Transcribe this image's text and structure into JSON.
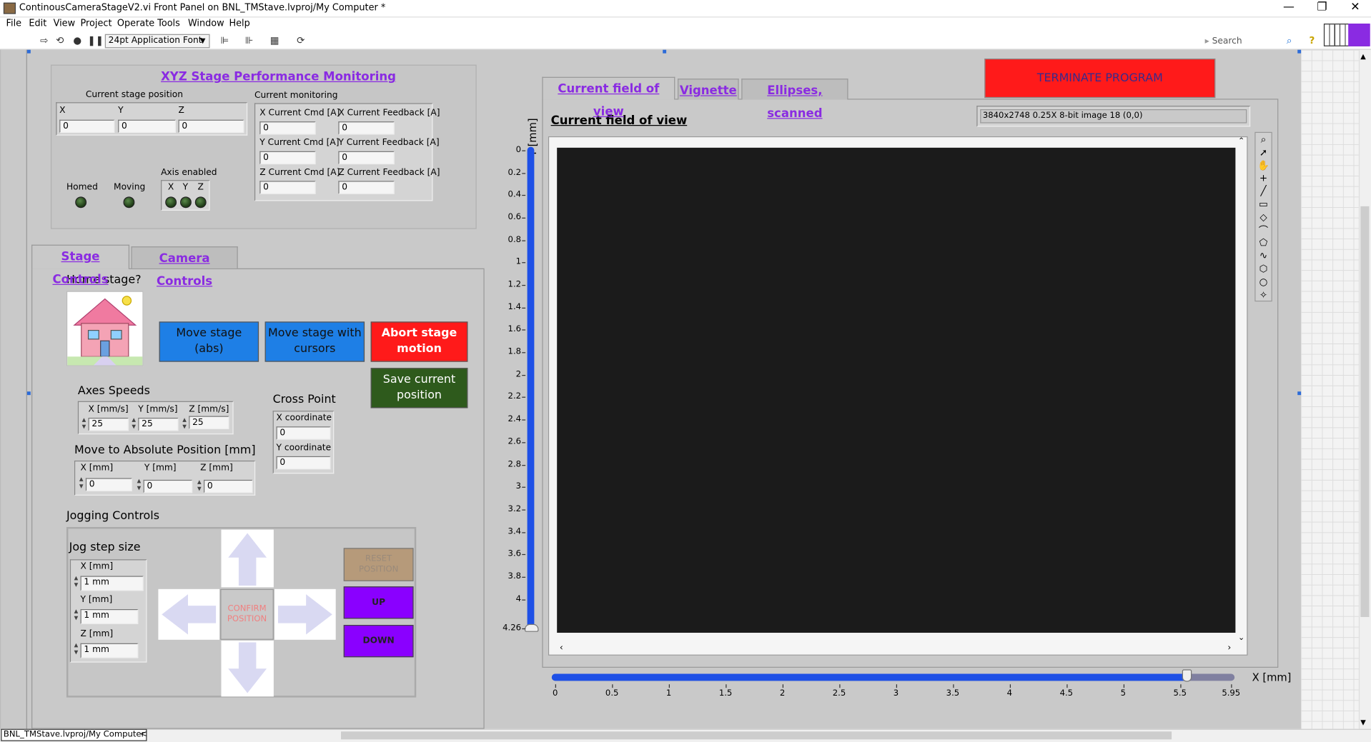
{
  "window": {
    "title": "ContinousCameraStageV2.vi Front Panel on BNL_TMStave.lvproj/My Computer *",
    "minimize": "—",
    "maximize": "❐",
    "close": "✕"
  },
  "menu": [
    "File",
    "Edit",
    "View",
    "Project",
    "Operate",
    "Tools",
    "Window",
    "Help"
  ],
  "toolbar": {
    "font": "24pt Application Font",
    "search_placeholder": "Search",
    "help": "?"
  },
  "status": {
    "project": "BNL_TMStave.lvproj/My Computer",
    "arrow": "<"
  },
  "monitor": {
    "title": "XYZ Stage Performance Monitoring",
    "position_label": "Current stage position",
    "axis_labels": [
      "X",
      "Y",
      "Z"
    ],
    "axis_values": [
      "0",
      "0",
      "0"
    ],
    "homed": "Homed",
    "moving": "Moving",
    "axis_enabled": "Axis enabled",
    "current_monitoring": "Current monitoring",
    "cmd_labels": [
      "X Current Cmd [A]",
      "Y Current Cmd [A]",
      "Z Current Cmd [A]"
    ],
    "cmd_values": [
      "0",
      "0",
      "0"
    ],
    "fb_labels": [
      "X Current Feedback [A]",
      "Y Current Feedback [A]",
      "Z Current Feedback [A]"
    ],
    "fb_values": [
      "0",
      "0",
      "0"
    ]
  },
  "left_tabs": [
    "Stage Controls",
    "Camera Controls"
  ],
  "stage": {
    "home_label": "Home stage?",
    "move_abs": "Move stage (abs)",
    "move_cursors": "Move stage with cursors",
    "abort": "Abort stage motion",
    "save": "Save current position",
    "speeds_label": "Axes Speeds",
    "speed_labels": [
      "X [mm/s]",
      "Y [mm/s]",
      "Z [mm/s]"
    ],
    "speed_values": [
      "25",
      "25",
      "25"
    ],
    "cross_label": "Cross Point",
    "cross_x_label": "X coordinate",
    "cross_x": "0",
    "cross_y_label": "Y coordinate",
    "cross_y": "0",
    "abs_label": "Move to Absolute Position [mm]",
    "abs_labels": [
      "X [mm]",
      "Y [mm]",
      "Z [mm]"
    ],
    "abs_values": [
      "0",
      "0",
      "0"
    ],
    "jog_label": "Jogging Controls",
    "jog_step_label": "Jog step size",
    "jog_labels": [
      "X [mm]",
      "Y [mm]",
      "Z [mm]"
    ],
    "jog_values": [
      "1 mm",
      "1 mm",
      "1 mm"
    ],
    "confirm": "CONFIRM POSITION",
    "reset": "RESET POSITION",
    "up": "UP",
    "down": "DOWN"
  },
  "right_tabs": [
    "Current field of view",
    "Vignette",
    "Ellipses, scanned"
  ],
  "terminate": "TERMINATE PROGRAM",
  "view": {
    "title": "Current field of view",
    "image_info": "3840x2748 0.25X 8-bit image 18     (0,0)",
    "y_axis_label": "Y [mm]",
    "y_ticks": [
      "0",
      "0.2",
      "0.4",
      "0.6",
      "0.8",
      "1",
      "1.2",
      "1.4",
      "1.6",
      "1.8",
      "2",
      "2.2",
      "2.4",
      "2.6",
      "2.8",
      "3",
      "3.2",
      "3.4",
      "3.6",
      "3.8",
      "4",
      "4.26"
    ],
    "x_axis_label": "X [mm]",
    "x_ticks": [
      "0",
      "0.5",
      "1",
      "1.5",
      "2",
      "2.5",
      "3",
      "3.5",
      "4",
      "4.5",
      "5",
      "5.5",
      "5.95"
    ],
    "x_slider_fraction": 0.93,
    "y_slider_fraction": 1.0
  },
  "colors": {
    "panel": "#c9c9c9",
    "link": "#8a2be2",
    "blue_btn": "#1e7fe6",
    "red_btn": "#ff1a1a",
    "green_btn": "#2e5a1c",
    "purple_btn": "#8a00ff",
    "tan_btn": "#b69a7a"
  }
}
